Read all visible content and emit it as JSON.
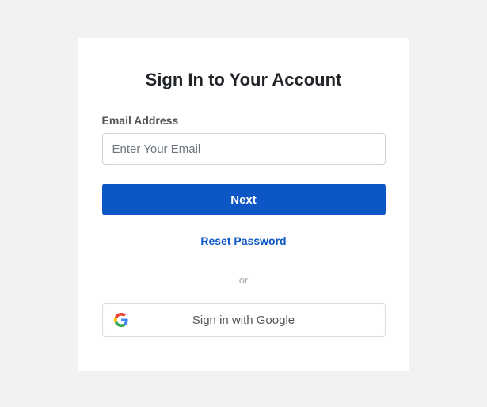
{
  "title": "Sign In to Your Account",
  "email": {
    "label": "Email Address",
    "placeholder": "Enter Your Email",
    "value": ""
  },
  "buttons": {
    "next": "Next",
    "google": "Sign in with Google"
  },
  "links": {
    "reset": "Reset Password"
  },
  "divider": "or",
  "icons": {
    "google": "google-icon"
  },
  "colors": {
    "primary": "#0c57c5",
    "card_bg": "#ffffff",
    "page_bg": "#f2f2f2"
  }
}
